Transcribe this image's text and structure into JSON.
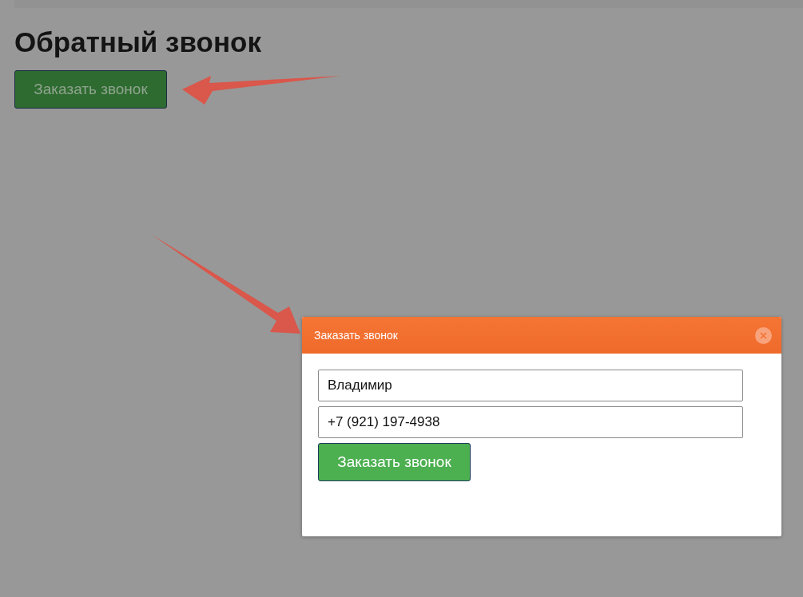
{
  "page": {
    "title": "Обратный звонок",
    "button": "Заказать звонок"
  },
  "modal": {
    "title": "Заказать звонок",
    "fields": [
      {
        "value": "Владимир"
      },
      {
        "value": "+7 (921) 197-4938"
      }
    ],
    "submit": "Заказать звонок"
  }
}
